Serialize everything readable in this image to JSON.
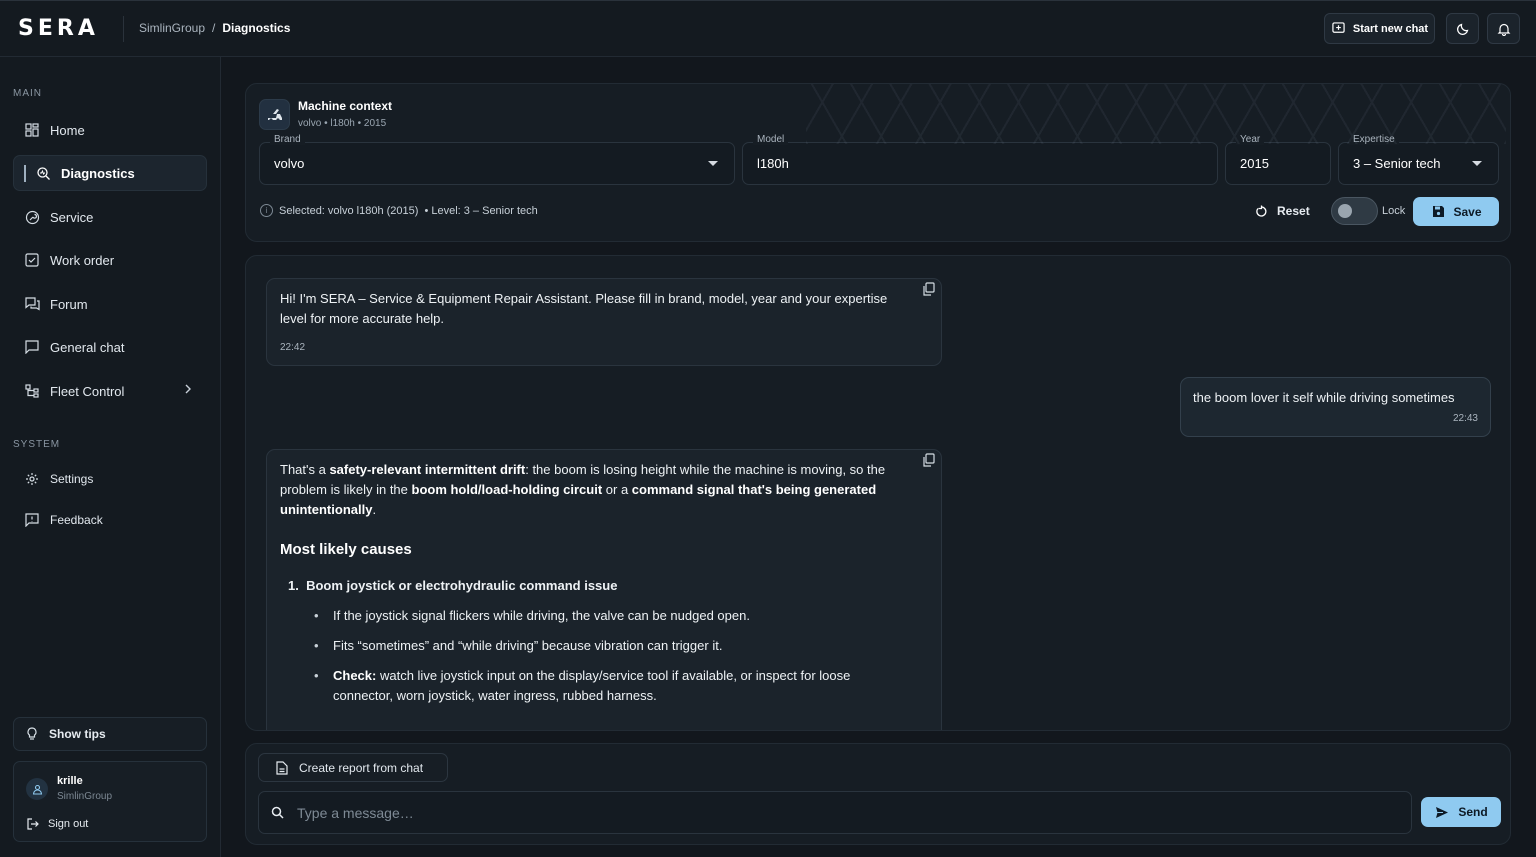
{
  "app": {
    "logo": "SERA"
  },
  "breadcrumb": {
    "group": "SimlinGroup",
    "separator": "/",
    "current": "Diagnostics"
  },
  "header": {
    "new_chat_label": "Start new chat",
    "theme_icon": "moon-icon",
    "notification_icon": "bell-icon"
  },
  "sidebar": {
    "main_label": "MAIN",
    "system_label": "SYSTEM",
    "items": [
      {
        "label": "Home",
        "icon": "grid-icon"
      },
      {
        "label": "Diagnostics",
        "icon": "search-diagnostic-icon",
        "active": true
      },
      {
        "label": "Service",
        "icon": "wrench-circle-icon"
      },
      {
        "label": "Work order",
        "icon": "checkbox-icon"
      },
      {
        "label": "Forum",
        "icon": "forum-icon"
      },
      {
        "label": "General chat",
        "icon": "chat-icon"
      },
      {
        "label": "Fleet Control",
        "icon": "hierarchy-icon",
        "has_submenu": true
      }
    ],
    "system_items": [
      {
        "label": "Settings",
        "icon": "gear-icon"
      },
      {
        "label": "Feedback",
        "icon": "feedback-icon"
      }
    ],
    "tips_label": "Show tips",
    "user": {
      "name": "krille",
      "org": "SimlinGroup",
      "sign_out": "Sign out"
    }
  },
  "context": {
    "title": "Machine context",
    "subtitle": "volvo • l180h • 2015",
    "brand_label": "Brand",
    "brand_value": "volvo",
    "model_label": "Model",
    "model_value": "l180h",
    "year_label": "Year",
    "year_value": "2015",
    "expertise_label": "Expertise",
    "expertise_value": "3 – Senior tech",
    "selected_text": "Selected: volvo l180h (2015)",
    "level_text": "• Level: 3 – Senior tech",
    "reset_label": "Reset",
    "lock_label": "Lock",
    "lock_on": false,
    "save_label": "Save"
  },
  "messages": {
    "bot1": {
      "text": "Hi! I'm SERA – Service & Equipment Repair Assistant. Please fill in brand, model, year and your expertise level for more accurate help.",
      "time": "22:42"
    },
    "user1": {
      "text": "the boom lover it self while driving sometimes",
      "time": "22:43"
    },
    "bot2": {
      "p1_a": "That's a ",
      "p1_b": "safety-relevant intermittent drift",
      "p1_c": ": the boom is losing height while the machine is moving, so the problem is likely in the ",
      "p1_d": "boom hold/load-holding circuit",
      "p1_e": " or a ",
      "p1_f": "command signal that's being generated unintentionally",
      "p1_g": ".",
      "heading": "Most likely causes",
      "item1_num": "1.",
      "item1_title": "Boom joystick or electrohydraulic command issue",
      "bullet1": "If the joystick signal flickers while driving, the valve can be nudged open.",
      "bullet2": "Fits “sometimes” and “while driving” because vibration can trigger it.",
      "bullet3_bold": "Check:",
      "bullet3_rest": " watch live joystick input on the display/service tool if available, or inspect for loose connector, worn joystick, water ingress, rubbed harness."
    }
  },
  "composer": {
    "report_label": "Create report from chat",
    "placeholder": "Type a message…",
    "send_label": "Send"
  },
  "colors": {
    "accent": "#8fcaf0",
    "background": "#12171d",
    "panel": "#161d24"
  }
}
